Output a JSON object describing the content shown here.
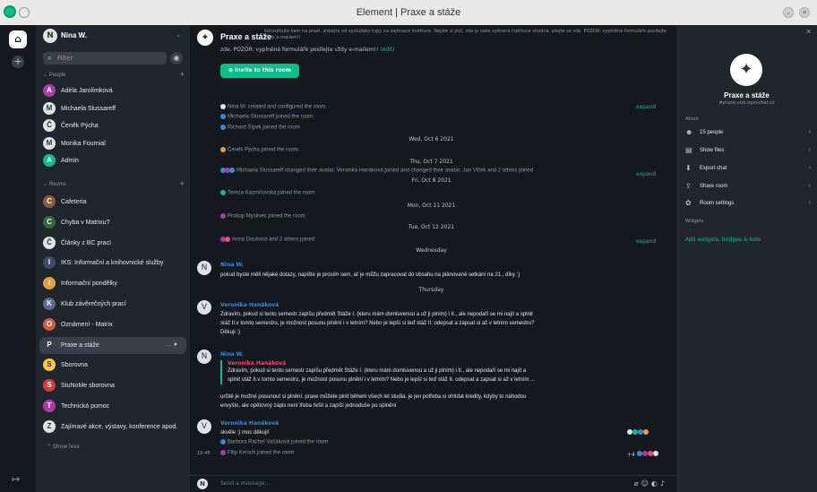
{
  "window": {
    "title": "Element | Praxe a stáže"
  },
  "user": {
    "name": "Nina W."
  },
  "filter": {
    "placeholder": "Filter"
  },
  "sections": {
    "people": "People",
    "rooms": "Rooms",
    "show_less": "Show less"
  },
  "people": [
    {
      "name": "Adéla Jarolímková",
      "initial": "A",
      "color": "#ac3ba8"
    },
    {
      "name": "Michaela Slussareff",
      "initial": "M",
      "color": "#dfe3e6"
    },
    {
      "name": "Čeněk Pýcha",
      "initial": "Č",
      "color": "#dfe3e6"
    },
    {
      "name": "Monika Fournial",
      "initial": "M",
      "color": "#dfe3e6"
    },
    {
      "name": "Admin",
      "initial": "A",
      "color": "#0dbd8b"
    }
  ],
  "rooms": [
    {
      "name": "Cafeteria",
      "initial": "C",
      "color": "#8a5a3a"
    },
    {
      "name": "Chyba v Matrixu?",
      "initial": "C",
      "color": "#2f6b3a"
    },
    {
      "name": "Články z BC prací",
      "initial": "Č",
      "color": "#dfe3e6"
    },
    {
      "name": "IKS: Informační a knihovnické služby",
      "initial": "I",
      "color": "#3a4a6b"
    },
    {
      "name": "Informační pondělky",
      "initial": "I",
      "color": "#e0a040"
    },
    {
      "name": "Klub závěrečných prací",
      "initial": "K",
      "color": "#5a6a8a"
    },
    {
      "name": "Oznámení - Matrix",
      "initial": "O",
      "color": "#d05a40"
    },
    {
      "name": "Praxe a stáže",
      "initial": "P",
      "color": "#394049",
      "active": true
    },
    {
      "name": "Sborovna",
      "initial": "S",
      "color": "#f2c94c"
    },
    {
      "name": "StuNoMe sborovna",
      "initial": "S",
      "color": "#d04040"
    },
    {
      "name": "Technická pomoc",
      "initial": "T",
      "color": "#ac3ba8"
    },
    {
      "name": "Zajímavé akce, výstavy, konference apod.",
      "initial": "Z",
      "color": "#dfe3e6"
    }
  ],
  "room": {
    "name": "Praxe a stáže",
    "topic_line1": "Konzultujte kam na praxi, získejte od spolužáky typy na zajímavé instituce. Nejste si jistí, zda je vaše vybraná instituce vhodná, ptejte se zde. POZOR: vyplněné formuláře posílejte",
    "topic_line2": "vždy e-mailem!!",
    "topic_cont": "zde. POZOR: vyplněné formuláře posílejte vždy e-mailem!! ",
    "edit": "(edit)",
    "alias": "#praxe:uisk.openchat.cz"
  },
  "invite_label": "Invite to this room",
  "timeline": {
    "ev1": "Nina W. created and configured the room.",
    "ev2": "Michaela Slussareff joined the room",
    "ev3": "Richard Šípek joined the room",
    "d1": "Wed, Oct 6 2021",
    "ev4": "Čeněk Pýcha joined the room",
    "d2": "Thu, Oct 7 2021",
    "ev5": "Michaela Slussareff changed their avatar, Veronika Hanáková joined and changed their avatar, Jan Vlček and 2 others joined",
    "d3": "Fri, Oct 8 2021",
    "ev6": "Tereza Kazmírovská joined the room",
    "d4": "Mon, Oct 11 2021",
    "ev7": "Prokop Myslivec joined the room",
    "d5": "Tue, Oct 12 2021",
    "ev8": "Anna Doušová and 2 others joined",
    "d6": "Wednesday",
    "expand": "expand",
    "m1_sender": "Nina W.",
    "m1_body": "pokud byste měli nějaké dotazy, napište je prosím sem, ať je můžu zapracovat do obsahu na plánované setkání na 21., díky :)",
    "d7": "Thursday",
    "m2_sender": "Veronika Hanáková",
    "m2_body_1": "Zdravím, pokud si tento semestr zapíšu předmět Stáže I. (kteru mám domluvenou a už ji plním) i II., ale nepodaří se mi najít a splnit",
    "m2_body_2": "stáž II.v tomto semestru, je možnost posunu plnění i v letním? Nebo je lepší si teď stáž II. odepsat a zapsat si až v letním semestru?",
    "m2_body_3": "Děkuji :)",
    "m3_sender": "Nina W.",
    "m3_quote_sender": "Veronika Hanáková",
    "m3_quote_1": "Zdravím, pokud si tento semestr zapíšu předmět Stáže I. (kteru mám domluvenou a už ji plním) i II., ale nepodaří se mi najít a",
    "m3_quote_2": "splnit stáž II.v tomto semestru, je možnost posunu plnění i v letním? Nebo je lepší si teď stáž II. odepsat a zapsat si až v letním ...",
    "m3_body_1": "určitě je možné posunout si plnění. praxe můžete plnit během všech let studia. je jen potřeba si ohlídat kredity, kdyby to náhodou",
    "m3_body_2": "envyšlo, ale opětovný zápis není třeba řešit a zapíší jednoduše po splnění",
    "m4_sender": "Veronika Hanáková",
    "m4_body": "skvěle :) moc děkuji!",
    "ev9": "Barbora Rachel Vašáková joined the room",
    "ev10": "Filip Kersch joined the room",
    "ts": "19:48",
    "receipts_extra": "+4"
  },
  "composer": {
    "placeholder": "Send a message..."
  },
  "right": {
    "about": "About",
    "people": "15 people",
    "files": "Show files",
    "export": "Export chat",
    "share": "Share room",
    "settings": "Room settings",
    "widgets_h": "Widgets",
    "widgets": "Add widgets, bridges & bots"
  },
  "colors": {
    "accent": "#0dbd8b",
    "bg_main": "#15191e",
    "bg_panel": "#21262c"
  }
}
